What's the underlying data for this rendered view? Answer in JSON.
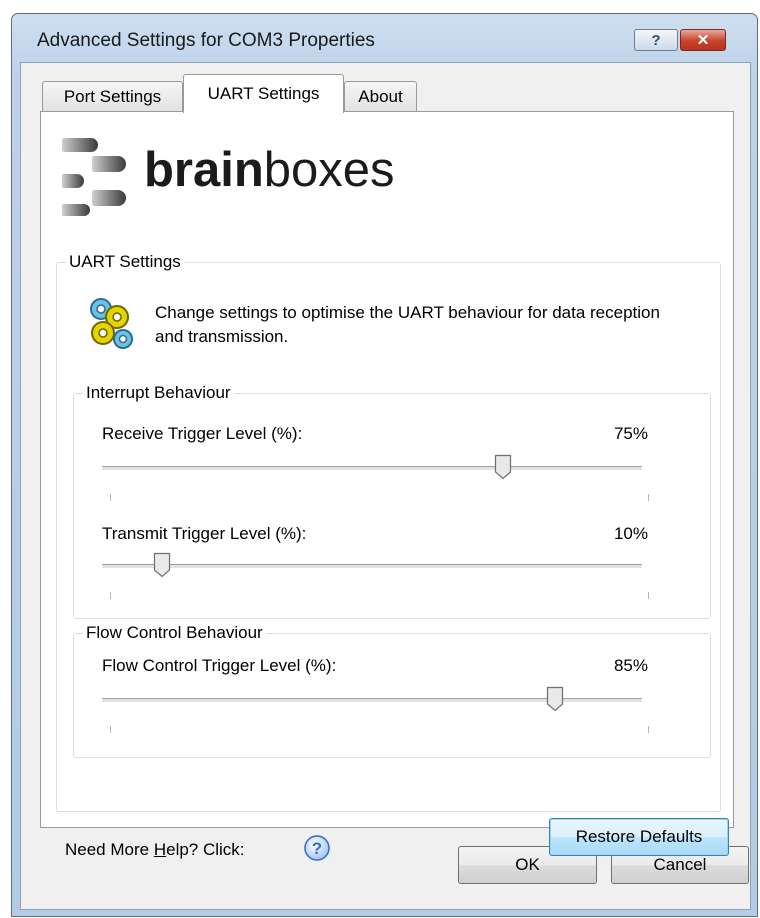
{
  "window": {
    "title": "Advanced Settings for COM3 Properties",
    "help_glyph": "?",
    "close_glyph": "✕"
  },
  "tabs": [
    {
      "label": "Port Settings",
      "active": false
    },
    {
      "label": "UART Settings",
      "active": true
    },
    {
      "label": "About",
      "active": false
    }
  ],
  "logo": {
    "part1": "brain",
    "part2": "boxes"
  },
  "uart_group": {
    "label": "UART Settings",
    "description": "Change settings to optimise the UART behaviour for data reception and transmission.",
    "icon": "gears-icon"
  },
  "interrupt_group": {
    "label": "Interrupt Behaviour",
    "sliders": [
      {
        "label": "Receive Trigger Level (%):",
        "value_text": "75%",
        "position": 0.75
      },
      {
        "label": "Transmit Trigger Level (%):",
        "value_text": "10%",
        "position": 0.1
      }
    ]
  },
  "flow_group": {
    "label": "Flow Control Behaviour",
    "slider": {
      "label": "Flow Control Trigger Level (%):",
      "value_text": "85%",
      "position": 0.85
    }
  },
  "help": {
    "pre": "Need More ",
    "underlined": "H",
    "post": "elp? Click:",
    "icon": "help-question-icon"
  },
  "buttons": {
    "restore": "Restore Defaults",
    "ok": "OK",
    "cancel": "Cancel"
  },
  "colors": {
    "accent": "#3c7fb1",
    "close": "#c9432b",
    "help_icon": "#2f6fc4"
  }
}
